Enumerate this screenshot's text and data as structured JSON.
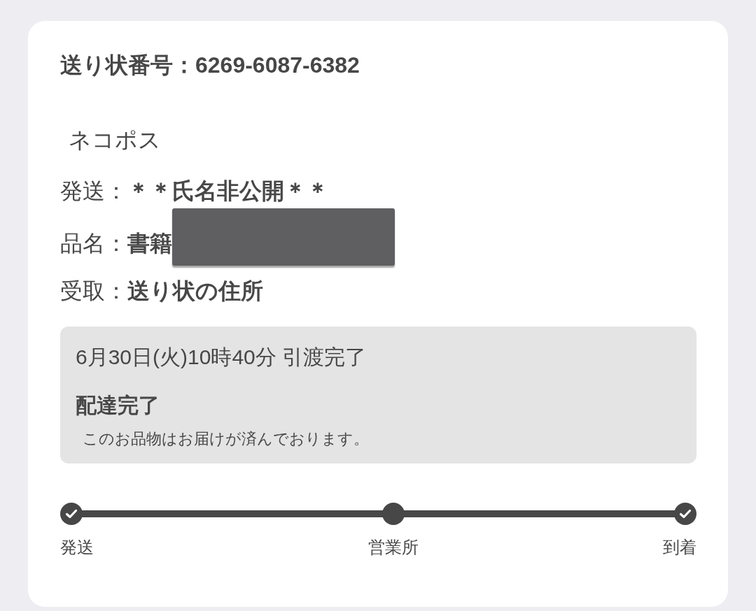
{
  "header": {
    "title": "送り状番号：6269-6087-6382"
  },
  "service": "ネコポス",
  "details": [
    {
      "label": "発送：",
      "value": "＊＊氏名非公開＊＊",
      "redacted": false
    },
    {
      "label": "品名：",
      "value": "書籍",
      "redacted": true
    },
    {
      "label": "受取：",
      "value": "送り状の住所",
      "redacted": false
    }
  ],
  "status": {
    "timestamp": "6月30日(火)10時40分 引渡完了",
    "title": "配達完了",
    "message": "このお品物はお届けが済んでおります。"
  },
  "progress": {
    "steps": [
      {
        "label": "発送",
        "checked": true
      },
      {
        "label": "営業所",
        "checked": false
      },
      {
        "label": "到着",
        "checked": true
      }
    ]
  }
}
